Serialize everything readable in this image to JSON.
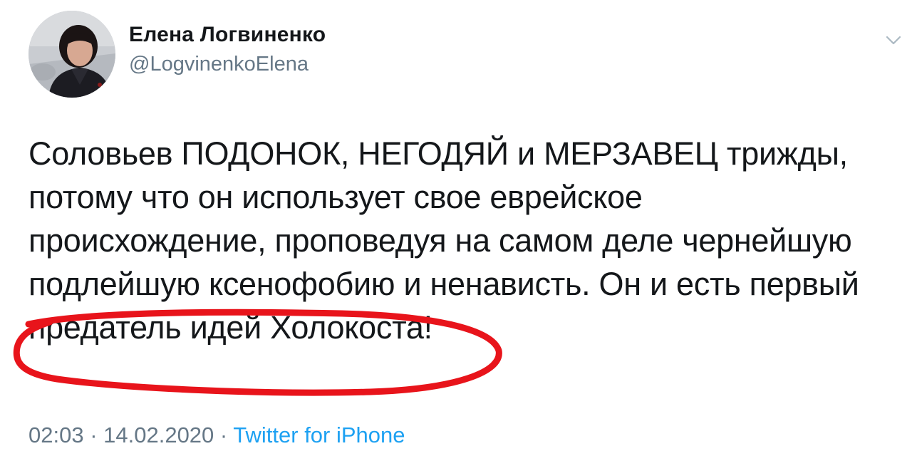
{
  "author": {
    "display_name": "Елена Логвиненко",
    "handle": "@LogvinenkoElena",
    "avatar_icon": "profile-photo"
  },
  "menu": {
    "icon": "chevron-down-icon"
  },
  "tweet": {
    "lines": [
      "Соловьев ПОДОНОК, НЕГОДЯЙ и МЕРЗАВЕЦ трижды,",
      "потому что он использует свое еврейское",
      "происхождение, проповедуя на самом деле чернейшую",
      "подлейшую ксенофобию и ненависть. Он и есть первый",
      "предатель идей Холокоста!"
    ]
  },
  "meta": {
    "time": "02:03",
    "date": "14.02.2020",
    "separator": " · ",
    "source": "Twitter for iPhone"
  },
  "colors": {
    "text": "#14171a",
    "secondary": "#657786",
    "link": "#1da1f2",
    "highlight": "#e8141b"
  }
}
